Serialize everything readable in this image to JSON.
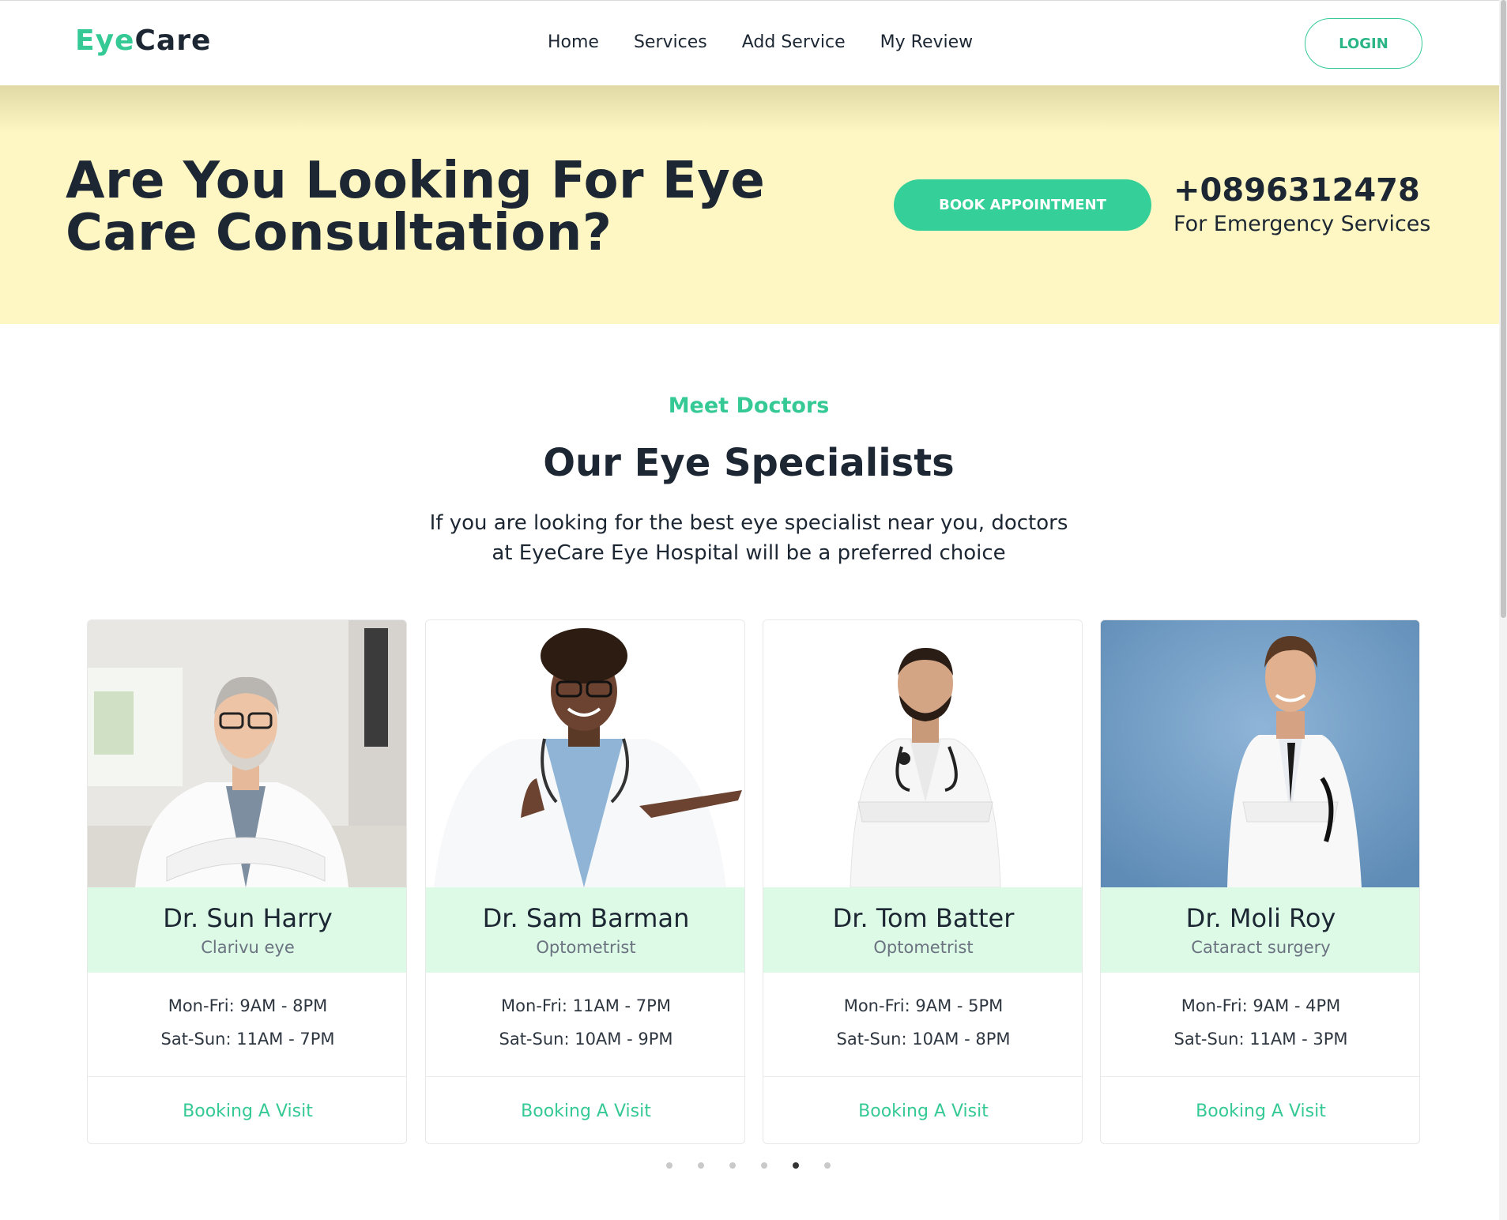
{
  "header": {
    "logo_part1": "Eye",
    "logo_part2": "Care",
    "nav": [
      "Home",
      "Services",
      "Add Service",
      "My Review"
    ],
    "login_label": "LOGIN"
  },
  "hero": {
    "title": "Are You Looking For Eye Care Consultation?",
    "book_label": "BOOK APPOINTMENT",
    "phone": "+0896312478",
    "phone_caption": "For Emergency Services"
  },
  "section": {
    "kicker": "Meet Doctors",
    "title": "Our Eye Specialists",
    "description": "If you are looking for the best eye specialist near you, doctors at EyeCare Eye Hospital will be a preferred choice"
  },
  "doctors": [
    {
      "name": "Dr. Sun Harry",
      "specialty": "Clarivu eye",
      "weekday": "Mon-Fri: 9AM - 8PM",
      "weekend": "Sat-Sun: 11AM - 7PM",
      "cta": "Booking A Visit"
    },
    {
      "name": "Dr. Sam Barman",
      "specialty": "Optometrist",
      "weekday": "Mon-Fri: 11AM - 7PM",
      "weekend": "Sat-Sun: 10AM - 9PM",
      "cta": "Booking A Visit"
    },
    {
      "name": "Dr. Tom Batter",
      "specialty": "Optometrist",
      "weekday": "Mon-Fri: 9AM - 5PM",
      "weekend": "Sat-Sun: 10AM - 8PM",
      "cta": "Booking A Visit"
    },
    {
      "name": "Dr. Moli Roy",
      "specialty": "Cataract surgery",
      "weekday": "Mon-Fri: 9AM - 4PM",
      "weekend": "Sat-Sun: 11AM - 3PM",
      "cta": "Booking A Visit"
    }
  ],
  "carousel": {
    "total_dots": 6,
    "active_index": 4
  },
  "colors": {
    "accent": "#35c995",
    "hero_bg": "#fef7c3",
    "name_bg": "#dcfae6",
    "text": "#1c2733"
  }
}
